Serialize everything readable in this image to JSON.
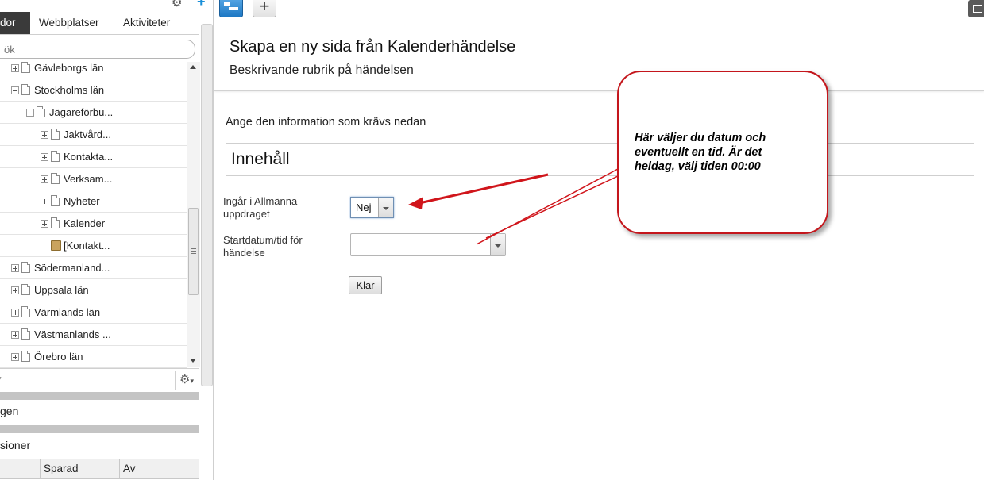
{
  "left_panel": {
    "tabs": [
      {
        "label": "dor",
        "active": true
      },
      {
        "label": "Webbplatser",
        "active": false
      },
      {
        "label": "Aktiviteter",
        "active": false
      }
    ],
    "search_placeholder": "ök",
    "tree": [
      {
        "label": "Gävleborgs län",
        "expander": "plus",
        "icon": "page",
        "level": 0
      },
      {
        "label": "Stockholms län",
        "expander": "minus",
        "icon": "page",
        "level": 0
      },
      {
        "label": "Jägareförbu...",
        "expander": "minus",
        "icon": "page",
        "level": 1
      },
      {
        "label": "Jaktvård...",
        "expander": "plus",
        "icon": "page",
        "level": 2
      },
      {
        "label": "Kontakta...",
        "expander": "plus",
        "icon": "page",
        "level": 2
      },
      {
        "label": "Verksam...",
        "expander": "plus",
        "icon": "page",
        "level": 2
      },
      {
        "label": "Nyheter",
        "expander": "plus",
        "icon": "page",
        "level": 2
      },
      {
        "label": "Kalender",
        "expander": "plus",
        "icon": "page",
        "level": 2
      },
      {
        "label": "[Kontakt...",
        "expander": "none",
        "icon": "block",
        "level": 2
      },
      {
        "label": "Södermanland...",
        "expander": "plus",
        "icon": "page",
        "level": 0
      },
      {
        "label": "Uppsala län",
        "expander": "plus",
        "icon": "page",
        "level": 0
      },
      {
        "label": "Värmlands län",
        "expander": "plus",
        "icon": "page",
        "level": 0
      },
      {
        "label": "Västmanlands ...",
        "expander": "plus",
        "icon": "page",
        "level": 0
      },
      {
        "label": "Örebro län",
        "expander": "plus",
        "icon": "page",
        "level": 0
      }
    ],
    "section_gen": "gen",
    "section_versions": "sioner",
    "grid_headers": [
      "",
      "Sparad",
      "Av"
    ]
  },
  "toolbar": {
    "tree_icon": "page-tree-icon",
    "add_label": "+"
  },
  "main": {
    "title": "Skapa en ny sida från Kalenderhändelse",
    "subtitle": "Beskrivande rubrik på händelsen",
    "intro": "Ange den information som krävs nedan",
    "group_title": "Innehåll",
    "field_allmanna_label_1": "Ingår i Allmänna",
    "field_allmanna_label_2": "uppdraget",
    "field_allmanna_value": "Nej",
    "field_start_label_1": "Startdatum/tid för",
    "field_start_label_2": "händelse",
    "field_start_value": "",
    "submit_label": "Klar"
  },
  "callout": {
    "text": "Här väljer du datum och eventuellt en tid. Är det heldag, välj tiden 00:00",
    "border_color": "#c4161c"
  },
  "colors": {
    "active_tab": "#3a3a3a",
    "annotation_red": "#d0151b"
  }
}
